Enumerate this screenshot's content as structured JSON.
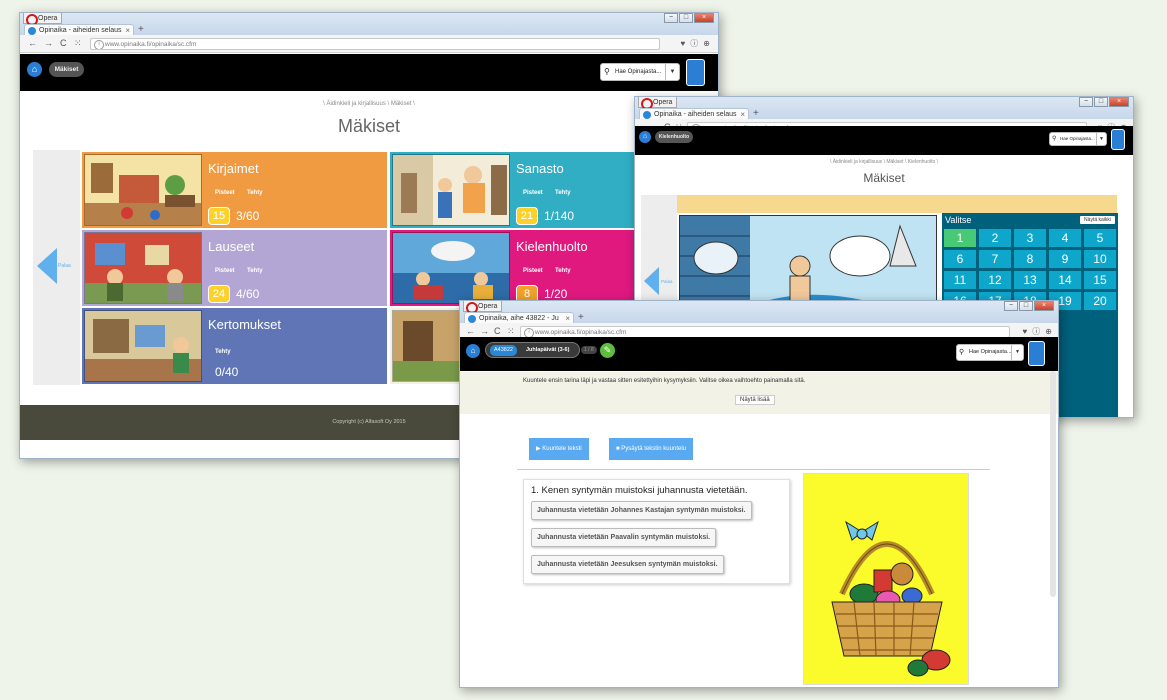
{
  "browser": {
    "menu_label": "Opera",
    "new_tab": "+",
    "close_tab": "×",
    "win_min": "−",
    "win_max": "□",
    "win_close": "×"
  },
  "win1": {
    "tab_title": "Opinaika - aiheiden selaus",
    "url": "www.opinaika.fi/opinaika/sc.cfm",
    "nav_pill": "Mäkiset",
    "search_placeholder": "Hae Opinajasta...",
    "breadcrumb": "\\ Äidinkieli ja kirjallisuus \\ Mäkiset \\",
    "page_title": "Mäkiset",
    "back_label": "Palaa",
    "tiles": [
      {
        "title": "Kirjaimet",
        "points_label": "Pisteet",
        "done_label": "Tehty",
        "points": "15",
        "done": "3/60",
        "color": "#f09a41"
      },
      {
        "title": "Sanasto",
        "points_label": "Pisteet",
        "done_label": "Tehty",
        "points": "21",
        "done": "1/140",
        "color": "#31aec4"
      },
      {
        "title": "Lauseet",
        "points_label": "Pisteet",
        "done_label": "Tehty",
        "points": "24",
        "done": "4/60",
        "color": "#b3a6d4"
      },
      {
        "title": "Kielenhuolto",
        "points_label": "Pisteet",
        "done_label": "Tehty",
        "points": "8",
        "done": "1/20",
        "color": "#e0197f"
      },
      {
        "title": "Kertomukset",
        "done_label": "Tehty",
        "done": "0/40",
        "color": "#5f75b5"
      }
    ],
    "footer": "Copyright (c) Alfasoft Oy 2015"
  },
  "win2": {
    "tab_title": "Opinaika - aiheiden selaus",
    "url": "www.opinaika.fi/opinaika/sc.cfm",
    "nav_pill": "Kielenhuolto",
    "search_placeholder": "Hae Opinajasta...",
    "breadcrumb": "\\ Äidinkieli ja kirjallisuus \\ Mäkiset \\ Kielenhuolto \\",
    "page_title": "Mäkiset",
    "back_label": "Palaa",
    "grid_title": "Valitse",
    "show_all": "Näytä kaikki",
    "numbers": [
      "1",
      "2",
      "3",
      "4",
      "5",
      "6",
      "7",
      "8",
      "9",
      "10",
      "11",
      "12",
      "13",
      "14",
      "15",
      "16",
      "17",
      "18",
      "19",
      "20"
    ],
    "selected": "1"
  },
  "win3": {
    "tab_title": "Opinaika, aihe 43822 - Ju",
    "url": "www.opinaika.fi/opinaika/sc.cfm",
    "unit_code": "A43822",
    "unit_title": "Juhlapäivät (3-6)",
    "page_counter": "1 / 8",
    "search_placeholder": "Hae Opinajasta...",
    "instruction": "Kuuntele ensin tarina läpi ja vastaa sitten esitettyihin kysymyksiin. Valitse oikea vaihtoehto painamalla sitä.",
    "show_more": "Näytä lisää",
    "listen_btn": "▶ Kuuntele teksti",
    "stop_btn": "■ Pysäytä tekstin kuuntelu",
    "question": "1. Kenen syntymän muistoksi juhannusta vietetään.",
    "answers": [
      "Juhannusta vietetään Johannes Kastajan syntymän muistoksi.",
      "Juhannusta vietetään Paavalin syntymän muistoksi.",
      "Juhannusta vietetään Jeesuksen syntymän muistoksi."
    ]
  }
}
